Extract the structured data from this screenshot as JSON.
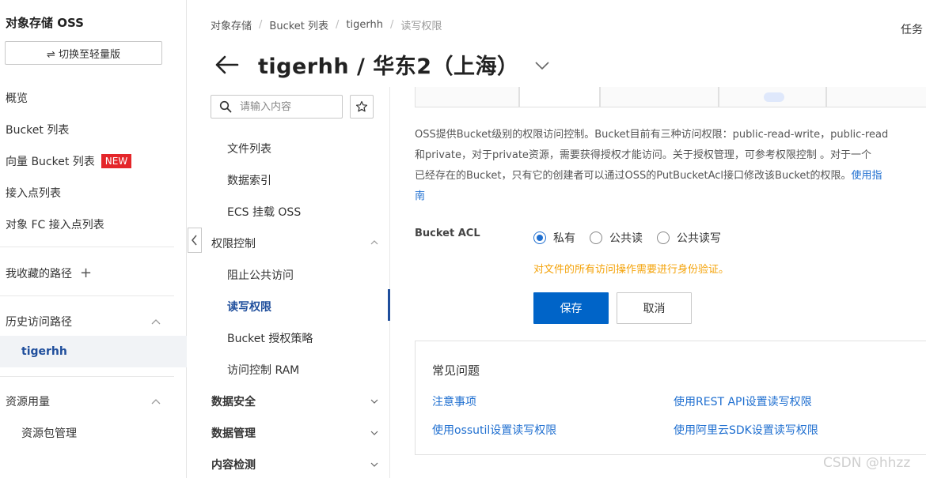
{
  "sidebar": {
    "title": "对象存储 OSS",
    "switch_button": "⇌ 切换至轻量版",
    "items": [
      {
        "label": "概览"
      },
      {
        "label": "Bucket 列表"
      },
      {
        "label": "向量 Bucket 列表",
        "badge": "NEW"
      },
      {
        "label": "接入点列表"
      },
      {
        "label": "对象 FC 接入点列表"
      }
    ],
    "favorites_label": "我收藏的路径",
    "favorites_add": "+",
    "history_label": "历史访问路径",
    "history_item": "tigerhh",
    "usage_label": "资源用量",
    "usage_item": "资源包管理"
  },
  "header": {
    "breadcrumb": [
      "对象存储",
      "Bucket 列表",
      "tigerhh",
      "读写权限"
    ],
    "breadcrumb_sep": "/",
    "task_text": "任务",
    "title": "tigerhh / 华东2（上海）"
  },
  "subnav": {
    "search_placeholder": "请输入内容",
    "items": [
      {
        "label": "文件列表"
      },
      {
        "label": "数据索引"
      },
      {
        "label": "ECS 挂载 OSS"
      }
    ],
    "group_permission": "权限控制",
    "permission_items": [
      {
        "label": "阻止公共访问"
      },
      {
        "label": "读写权限"
      },
      {
        "label": "Bucket 授权策略"
      },
      {
        "label": "访问控制 RAM"
      }
    ],
    "group_security": "数据安全",
    "group_management": "数据管理",
    "group_detection": "内容检测"
  },
  "main": {
    "description_1": "OSS提供Bucket级别的权限访问控制。Bucket目前有三种访问权限：public-read-write，public-read",
    "description_2": "和private，对于private资源，需要获得授权才能访问。关于授权管理，可参考权限控制 。对于一个",
    "description_3": "已经存在的Bucket，只有它的创建者可以通过OSS的PutBucketAcl接口修改该Bucket的权限。",
    "description_link_a": "使用指",
    "description_link_b": "南",
    "acl_label": "Bucket ACL",
    "acl_options": [
      {
        "label": "私有",
        "checked": true
      },
      {
        "label": "公共读",
        "checked": false
      },
      {
        "label": "公共读写",
        "checked": false
      }
    ],
    "acl_hint": "对文件的所有访问操作需要进行身份验证。",
    "save_label": "保存",
    "cancel_label": "取消",
    "faq": {
      "title": "常见问题",
      "links": [
        {
          "label": "注意事项"
        },
        {
          "label": "使用REST API设置读写权限"
        },
        {
          "label": "使用ossutil设置读写权限"
        },
        {
          "label": "使用阿里云SDK设置读写权限"
        }
      ]
    }
  },
  "watermark": "CSDN @hhzz",
  "colors": {
    "accent": "#0064c8",
    "link": "#1f6fd0",
    "active_nav": "#1f4e9c",
    "badge": "#e4262a",
    "warning": "#f4a30a"
  }
}
